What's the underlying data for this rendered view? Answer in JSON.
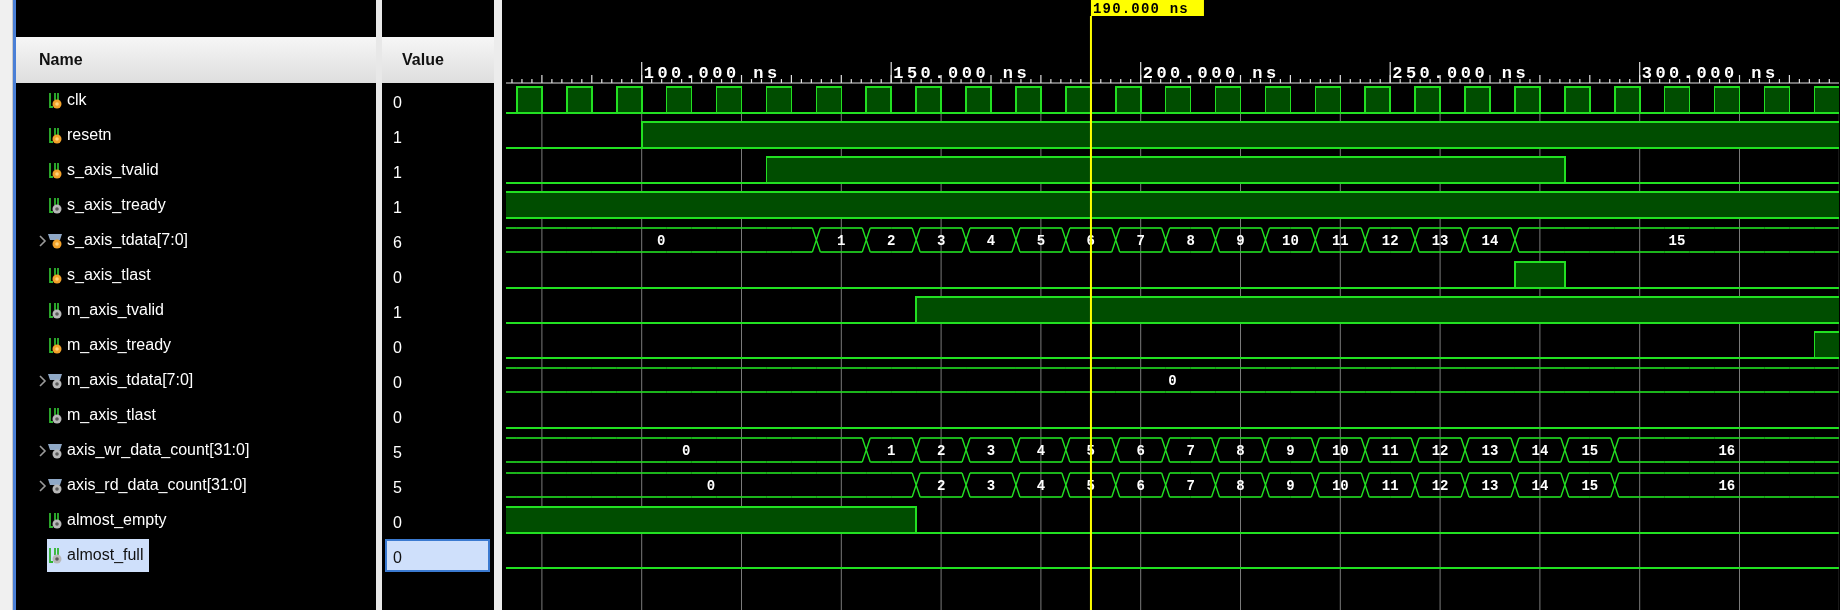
{
  "columns": [
    "Name",
    "Value"
  ],
  "timeline": {
    "labels": [
      "100.000 ns",
      "150.000 ns",
      "200.000 ns",
      "250.000 ns",
      "300.000 ns"
    ]
  },
  "cursor": {
    "label": "190.000 ns",
    "level": 0.4405
  },
  "signals": [
    {
      "name": "clk",
      "value": "0",
      "kind": "bit",
      "input": true,
      "selected": false,
      "high": [
        false,
        true,
        false,
        true,
        false,
        true,
        false,
        true,
        false,
        true,
        false,
        true,
        false,
        true,
        false,
        true,
        false,
        true,
        false,
        true,
        false,
        true,
        false,
        true,
        false,
        true,
        false,
        true,
        false,
        true,
        false,
        true,
        false,
        true,
        false,
        true,
        false,
        true,
        false,
        true,
        false,
        true,
        false,
        true,
        false,
        true,
        false,
        true,
        false,
        true,
        false,
        true,
        false,
        true
      ]
    },
    {
      "name": "resetn",
      "value": "1",
      "kind": "bit",
      "input": true,
      "selected": false,
      "high": [
        false,
        false,
        false,
        false,
        false,
        false,
        true
      ]
    },
    {
      "name": "s_axis_tvalid",
      "value": "1",
      "kind": "bit",
      "input": true,
      "selected": false,
      "high": [
        false,
        false,
        false,
        false,
        false,
        false,
        false,
        false,
        false,
        false,
        false,
        true,
        true,
        true,
        true,
        true,
        true,
        true,
        true,
        true,
        true,
        true,
        true,
        true,
        true,
        true,
        true,
        true,
        true,
        true,
        true,
        true,
        true,
        true,
        true,
        true,
        true,
        true,
        true,
        true,
        true,
        true,
        true,
        false
      ]
    },
    {
      "name": "s_axis_tready",
      "value": "1",
      "kind": "bit",
      "input": false,
      "selected": false,
      "high": [
        true
      ]
    },
    {
      "name": "s_axis_tdata[7:0]",
      "value": "6",
      "kind": "bus",
      "input": true,
      "selected": false,
      "expanded": false,
      "new_value": [
        true,
        false,
        false,
        false,
        false,
        false,
        false,
        false,
        false,
        false,
        false,
        false,
        false,
        true,
        false,
        true,
        false,
        true,
        false,
        true,
        false,
        true,
        false,
        true,
        false,
        true,
        false,
        true,
        false,
        true,
        false,
        true,
        false,
        true,
        false,
        true,
        false,
        true,
        false,
        true,
        false,
        true
      ],
      "labels": [
        "0",
        "1",
        "2",
        "3",
        "4",
        "5",
        "6",
        "7",
        "8",
        "9",
        "10",
        "11",
        "12",
        "13",
        "14",
        "15"
      ]
    },
    {
      "name": "s_axis_tlast",
      "value": "0",
      "kind": "bit",
      "input": true,
      "selected": false,
      "high": [
        false,
        false,
        false,
        false,
        false,
        false,
        false,
        false,
        false,
        false,
        false,
        false,
        false,
        false,
        false,
        false,
        false,
        false,
        false,
        false,
        false,
        false,
        false,
        false,
        false,
        false,
        false,
        false,
        false,
        false,
        false,
        false,
        false,
        false,
        false,
        false,
        false,
        false,
        false,
        false,
        false,
        true,
        true,
        false
      ]
    },
    {
      "name": "m_axis_tvalid",
      "value": "1",
      "kind": "bit",
      "input": false,
      "selected": false,
      "high": [
        false,
        false,
        false,
        false,
        false,
        false,
        false,
        false,
        false,
        false,
        false,
        false,
        false,
        false,
        false,
        false,
        false,
        true
      ]
    },
    {
      "name": "m_axis_tready",
      "value": "0",
      "kind": "bit",
      "input": true,
      "selected": false,
      "high": [
        false,
        false,
        false,
        false,
        false,
        false,
        false,
        false,
        false,
        false,
        false,
        false,
        false,
        false,
        false,
        false,
        false,
        false,
        false,
        false,
        false,
        false,
        false,
        false,
        false,
        false,
        false,
        false,
        false,
        false,
        false,
        false,
        false,
        false,
        false,
        false,
        false,
        false,
        false,
        false,
        false,
        false,
        false,
        false,
        false,
        false,
        false,
        false,
        false,
        false,
        false,
        false,
        false,
        true
      ]
    },
    {
      "name": "m_axis_tdata[7:0]",
      "value": "0",
      "kind": "bus",
      "input": false,
      "selected": false,
      "expanded": false,
      "new_value": [
        true
      ],
      "labels": [
        "0"
      ]
    },
    {
      "name": "m_axis_tlast",
      "value": "0",
      "kind": "bit",
      "input": false,
      "selected": false,
      "high": [
        false
      ]
    },
    {
      "name": "axis_wr_data_count[31:0]",
      "value": "5",
      "kind": "bus",
      "input": false,
      "selected": false,
      "expanded": false,
      "new_value": [
        true,
        false,
        false,
        false,
        false,
        false,
        false,
        false,
        false,
        false,
        false,
        false,
        false,
        false,
        false,
        true,
        false,
        true,
        false,
        true,
        false,
        true,
        false,
        true,
        false,
        true,
        false,
        true,
        false,
        true,
        false,
        true,
        false,
        true,
        false,
        true,
        false,
        true,
        false,
        true,
        false,
        true,
        false,
        true,
        false,
        true
      ],
      "labels": [
        "0",
        "1",
        "2",
        "3",
        "4",
        "5",
        "6",
        "7",
        "8",
        "9",
        "10",
        "11",
        "12",
        "13",
        "14",
        "15",
        "16"
      ]
    },
    {
      "name": "axis_rd_data_count[31:0]",
      "value": "5",
      "kind": "bus",
      "input": false,
      "selected": false,
      "expanded": false,
      "new_value": [
        true,
        false,
        false,
        false,
        false,
        false,
        false,
        false,
        false,
        false,
        false,
        false,
        false,
        false,
        false,
        false,
        false,
        true,
        false,
        true,
        false,
        true,
        false,
        true,
        false,
        true,
        false,
        true,
        false,
        true,
        false,
        true,
        false,
        true,
        false,
        true,
        false,
        true,
        false,
        true,
        false,
        true,
        false,
        true,
        false,
        true
      ],
      "labels": [
        "0",
        "2",
        "3",
        "4",
        "5",
        "6",
        "7",
        "8",
        "9",
        "10",
        "11",
        "12",
        "13",
        "14",
        "15",
        "16"
      ]
    },
    {
      "name": "almost_empty",
      "value": "0",
      "kind": "bit",
      "input": false,
      "selected": false,
      "high": [
        true,
        true,
        true,
        true,
        true,
        true,
        true,
        true,
        true,
        true,
        true,
        true,
        true,
        true,
        true,
        true,
        true,
        false
      ]
    },
    {
      "name": "almost_full",
      "value": "0",
      "kind": "bit",
      "input": false,
      "selected": true,
      "high": [
        false
      ]
    }
  ]
}
